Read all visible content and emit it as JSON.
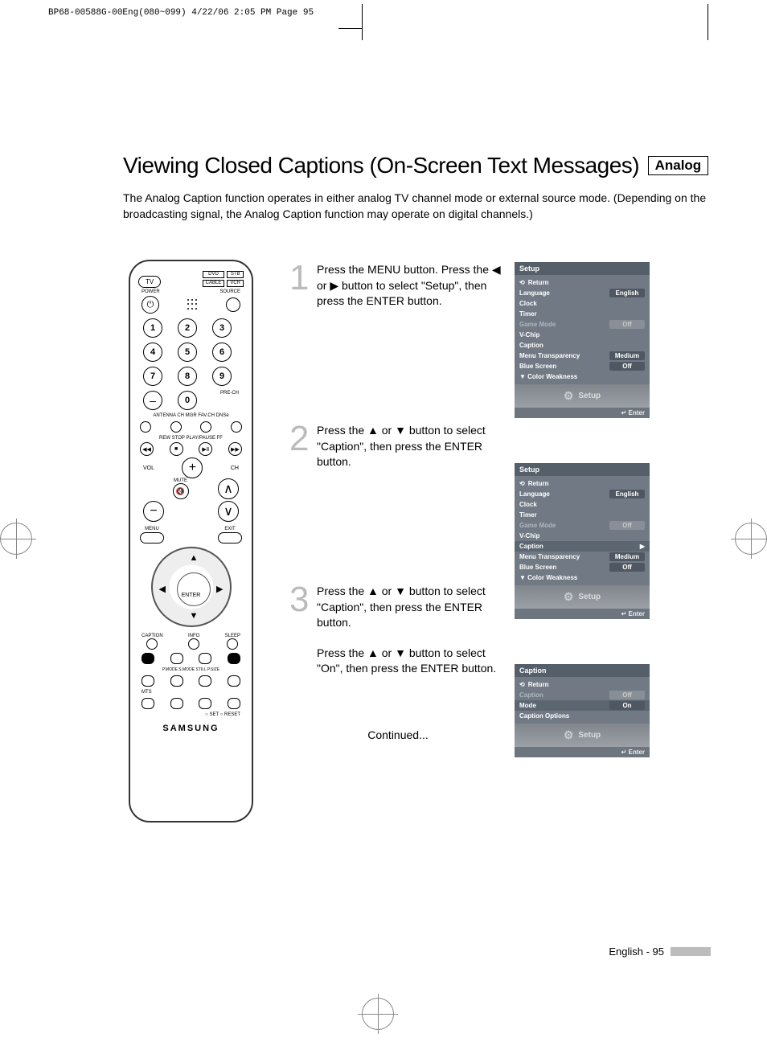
{
  "header_strip": "BP68-00588G-00Eng(080~099)  4/22/06  2:05 PM  Page 95",
  "title": "Viewing Closed Captions (On-Screen Text Messages)",
  "title_tag": "Analog",
  "intro": "The Analog Caption function operates in either analog TV channel mode or external source mode. (Depending on the broadcasting signal, the Analog Caption function may operate on digital channels.)",
  "remote": {
    "tv": "TV",
    "dvd": "DVD",
    "stb": "STB",
    "cable": "CABLE",
    "vcr": "VCR",
    "power": "POWER",
    "source": "SOURCE",
    "numbers": [
      "1",
      "2",
      "3",
      "4",
      "5",
      "6",
      "7",
      "8",
      "9"
    ],
    "zero": "0",
    "pre_ch": "PRE-CH",
    "labels1": "ANTENNA CH MGR  FAV.CH   DNSe",
    "transport_labels": "REW    STOP  PLAY/PAUSE  FF",
    "vol": "VOL",
    "ch": "CH",
    "mute": "MUTE",
    "menu": "MENU",
    "exit": "EXIT",
    "enter": "ENTER",
    "caption": "CAPTION",
    "info": "INFO",
    "sleep": "SLEEP",
    "pm": "P.MODE  S.MODE   STILL   P.SIZE",
    "mts": "MTS",
    "set_reset": "○ SET   ○ RESET",
    "brand": "SAMSUNG"
  },
  "steps": [
    {
      "num": "1",
      "text": "Press the MENU button.\nPress the ◀ or ▶ button to select \"Setup\", then press the ENTER button."
    },
    {
      "num": "2",
      "text": "Press the ▲ or ▼ button to select \"Caption\", then press the ENTER button."
    },
    {
      "num": "3",
      "text": "Press the ▲ or ▼ button to select \"Caption\", then press the ENTER button.",
      "text2": "Press the ▲ or ▼ button to select \"On\", then press the ENTER button."
    }
  ],
  "continued": "Continued...",
  "osd1": {
    "title": "Setup",
    "rows": [
      {
        "label": "Return",
        "type": "return"
      },
      {
        "label": "Language",
        "value": "English"
      },
      {
        "label": "Clock"
      },
      {
        "label": "Timer"
      },
      {
        "label": "Game Mode",
        "value": "Off",
        "dim": true
      },
      {
        "label": "V-Chip"
      },
      {
        "label": "Caption"
      },
      {
        "label": "Menu Transparency",
        "value": "Medium"
      },
      {
        "label": "Blue Screen",
        "value": "Off"
      },
      {
        "label": "▼ Color Weakness"
      }
    ],
    "footer_brand": "Setup",
    "footer_enter": "Enter"
  },
  "osd2": {
    "title": "Setup",
    "rows": [
      {
        "label": "Return",
        "type": "return"
      },
      {
        "label": "Language",
        "value": "English"
      },
      {
        "label": "Clock"
      },
      {
        "label": "Timer"
      },
      {
        "label": "Game Mode",
        "value": "Off",
        "dim": true
      },
      {
        "label": "V-Chip"
      },
      {
        "label": "Caption",
        "selected": true,
        "caret": true
      },
      {
        "label": "Menu Transparency",
        "value": "Medium"
      },
      {
        "label": "Blue Screen",
        "value": "Off"
      },
      {
        "label": "▼ Color Weakness"
      }
    ],
    "footer_brand": "Setup",
    "footer_enter": "Enter"
  },
  "osd3": {
    "title": "Caption",
    "rows": [
      {
        "label": "Return",
        "type": "return"
      },
      {
        "label": "Caption",
        "value": "Off",
        "dim": true
      },
      {
        "label": "Mode",
        "value": "On",
        "selected": true
      },
      {
        "label": "Caption Options"
      }
    ],
    "footer_brand": "Setup",
    "footer_enter": "Enter"
  },
  "page_footer": "English - 95"
}
